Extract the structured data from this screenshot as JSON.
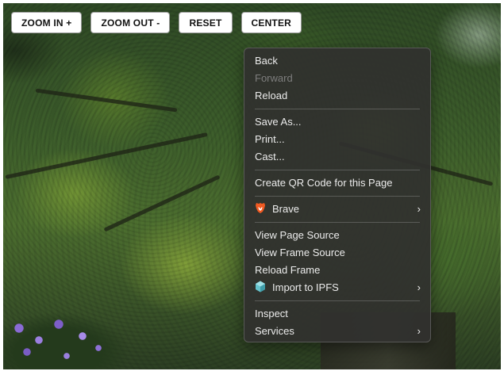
{
  "toolbar": {
    "zoom_in": "ZOOM IN +",
    "zoom_out": "ZOOM OUT -",
    "reset": "RESET",
    "center": "CENTER"
  },
  "context_menu": {
    "groups": [
      [
        {
          "label": "Back",
          "enabled": true
        },
        {
          "label": "Forward",
          "enabled": false
        },
        {
          "label": "Reload",
          "enabled": true
        }
      ],
      [
        {
          "label": "Save As...",
          "enabled": true
        },
        {
          "label": "Print...",
          "enabled": true
        },
        {
          "label": "Cast...",
          "enabled": true
        }
      ],
      [
        {
          "label": "Create QR Code for this Page",
          "enabled": true
        }
      ],
      [
        {
          "label": "Brave",
          "icon": "brave-lion-icon",
          "submenu": true,
          "enabled": true
        }
      ],
      [
        {
          "label": "View Page Source",
          "enabled": true
        },
        {
          "label": "View Frame Source",
          "enabled": true
        },
        {
          "label": "Reload Frame",
          "enabled": true
        },
        {
          "label": "Import to IPFS",
          "icon": "ipfs-cube-icon",
          "submenu": true,
          "enabled": true
        }
      ],
      [
        {
          "label": "Inspect",
          "enabled": true
        },
        {
          "label": "Services",
          "submenu": true,
          "enabled": true
        }
      ]
    ],
    "submenu_glyph": "›"
  },
  "colors": {
    "menu_bg": "#30302e",
    "menu_text": "#ececec",
    "menu_disabled_text": "#7d7d7d",
    "brave_orange": "#f15a22",
    "ipfs_teal": "#65c2cb"
  }
}
